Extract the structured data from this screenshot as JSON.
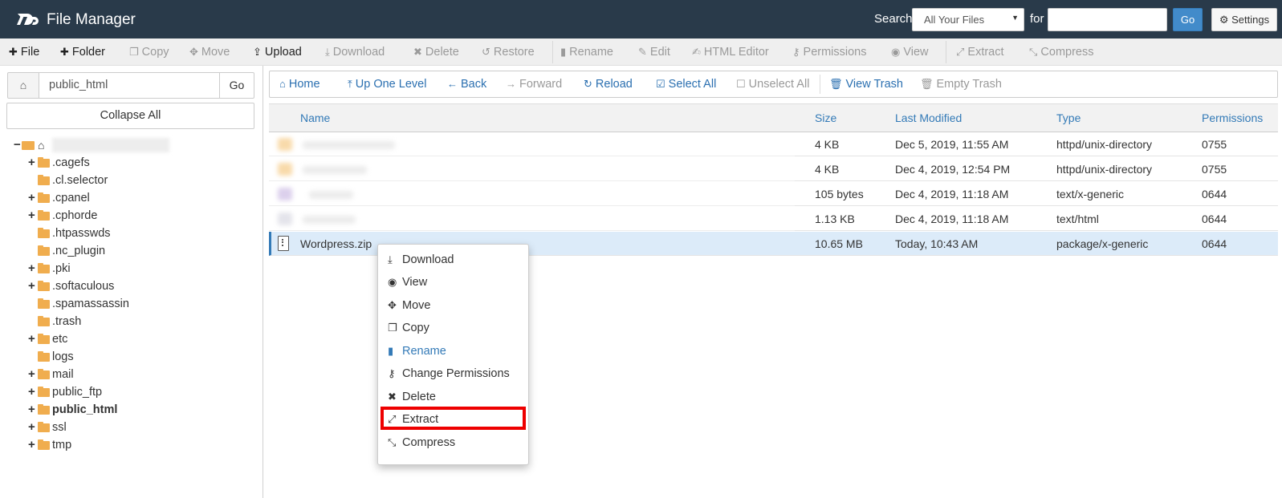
{
  "header": {
    "title": "File Manager",
    "search_label": "Search",
    "search_scope": "All Your Files",
    "for_label": "for",
    "search_value": "",
    "go_label": "Go",
    "settings_label": "Settings"
  },
  "toolbar": {
    "items": [
      {
        "label": "File",
        "icon": "plus-icon",
        "enabled": true
      },
      {
        "label": "Folder",
        "icon": "plus-icon",
        "enabled": true
      },
      {
        "label": "Copy",
        "icon": "copy-icon",
        "enabled": false
      },
      {
        "label": "Move",
        "icon": "move-icon",
        "enabled": false
      },
      {
        "label": "Upload",
        "icon": "upload-icon",
        "enabled": true
      },
      {
        "label": "Download",
        "icon": "download-icon",
        "enabled": false
      },
      {
        "label": "Delete",
        "icon": "close-icon",
        "enabled": false
      },
      {
        "label": "Restore",
        "icon": "undo-icon",
        "enabled": false
      },
      {
        "label": "Rename",
        "icon": "file-icon",
        "enabled": false
      },
      {
        "label": "Edit",
        "icon": "pencil-icon",
        "enabled": false
      },
      {
        "label": "HTML Editor",
        "icon": "edit-icon",
        "enabled": false
      },
      {
        "label": "Permissions",
        "icon": "key-icon",
        "enabled": false
      },
      {
        "label": "View",
        "icon": "eye-icon",
        "enabled": false
      },
      {
        "label": "Extract",
        "icon": "expand-icon",
        "enabled": false
      },
      {
        "label": "Compress",
        "icon": "compress-icon",
        "enabled": false
      }
    ]
  },
  "sidebar": {
    "path_value": "public_html",
    "go_label": "Go",
    "collapse_label": "Collapse All",
    "tree": [
      {
        "label": ".cagefs",
        "expandable": true,
        "bold": false
      },
      {
        "label": ".cl.selector",
        "expandable": false,
        "bold": false
      },
      {
        "label": ".cpanel",
        "expandable": true,
        "bold": false
      },
      {
        "label": ".cphorde",
        "expandable": true,
        "bold": false
      },
      {
        "label": ".htpasswds",
        "expandable": false,
        "bold": false
      },
      {
        "label": ".nc_plugin",
        "expandable": false,
        "bold": false
      },
      {
        "label": ".pki",
        "expandable": true,
        "bold": false
      },
      {
        "label": ".softaculous",
        "expandable": true,
        "bold": false
      },
      {
        "label": ".spamassassin",
        "expandable": false,
        "bold": false
      },
      {
        "label": ".trash",
        "expandable": false,
        "bold": false
      },
      {
        "label": "etc",
        "expandable": true,
        "bold": false
      },
      {
        "label": "logs",
        "expandable": false,
        "bold": false
      },
      {
        "label": "mail",
        "expandable": true,
        "bold": false
      },
      {
        "label": "public_ftp",
        "expandable": true,
        "bold": false
      },
      {
        "label": "public_html",
        "expandable": true,
        "bold": true
      },
      {
        "label": "ssl",
        "expandable": true,
        "bold": false
      },
      {
        "label": "tmp",
        "expandable": true,
        "bold": false
      }
    ]
  },
  "nav": {
    "items": [
      {
        "label": "Home",
        "icon": "home-icon",
        "enabled": true
      },
      {
        "label": "Up One Level",
        "icon": "level-up-icon",
        "enabled": true
      },
      {
        "label": "Back",
        "icon": "arrow-left-icon",
        "enabled": true
      },
      {
        "label": "Forward",
        "icon": "arrow-right-icon",
        "enabled": false
      },
      {
        "label": "Reload",
        "icon": "refresh-icon",
        "enabled": true
      },
      {
        "label": "Select All",
        "icon": "check-square-icon",
        "enabled": true
      },
      {
        "label": "Unselect All",
        "icon": "square-icon",
        "enabled": false
      },
      {
        "label": "View Trash",
        "icon": "trash-icon",
        "enabled": true
      },
      {
        "label": "Empty Trash",
        "icon": "trash-icon",
        "enabled": false
      }
    ]
  },
  "table": {
    "columns": [
      "Name",
      "Size",
      "Last Modified",
      "Type",
      "Permissions"
    ],
    "rows": [
      {
        "name": "",
        "size": "4 KB",
        "modified": "Dec 5, 2019, 11:55 AM",
        "type": "httpd/unix-directory",
        "perms": "0755",
        "blurred": true,
        "icon": "folder-icon",
        "selected": false
      },
      {
        "name": "",
        "size": "4 KB",
        "modified": "Dec 4, 2019, 12:54 PM",
        "type": "httpd/unix-directory",
        "perms": "0755",
        "blurred": true,
        "icon": "folder-icon",
        "selected": false
      },
      {
        "name": "",
        "size": "105 bytes",
        "modified": "Dec 4, 2019, 11:18 AM",
        "type": "text/x-generic",
        "perms": "0644",
        "blurred": true,
        "icon": "file-icon",
        "selected": false
      },
      {
        "name": "",
        "size": "1.13 KB",
        "modified": "Dec 4, 2019, 11:18 AM",
        "type": "text/html",
        "perms": "0644",
        "blurred": true,
        "icon": "file-icon",
        "selected": false
      },
      {
        "name": "Wordpress.zip",
        "size": "10.65 MB",
        "modified": "Today, 10:43 AM",
        "type": "package/x-generic",
        "perms": "0644",
        "blurred": false,
        "icon": "zip-file-icon",
        "selected": true
      }
    ]
  },
  "context_menu": {
    "items": [
      {
        "label": "Download",
        "icon": "download-icon"
      },
      {
        "label": "View",
        "icon": "eye-icon"
      },
      {
        "label": "Move",
        "icon": "move-icon"
      },
      {
        "label": "Copy",
        "icon": "copy-icon"
      },
      {
        "label": "Rename",
        "icon": "file-icon"
      },
      {
        "label": "Change Permissions",
        "icon": "key-icon"
      },
      {
        "label": "Delete",
        "icon": "close-icon"
      },
      {
        "label": "Extract",
        "icon": "expand-icon"
      },
      {
        "label": "Compress",
        "icon": "compress-icon"
      }
    ],
    "highlighted": "Extract"
  },
  "colors": {
    "header_bg": "#293a4a",
    "accent": "#337ab7",
    "folder": "#f0ad4e",
    "selected_row": "#dcebf9",
    "highlight_frame": "#ee0000"
  }
}
